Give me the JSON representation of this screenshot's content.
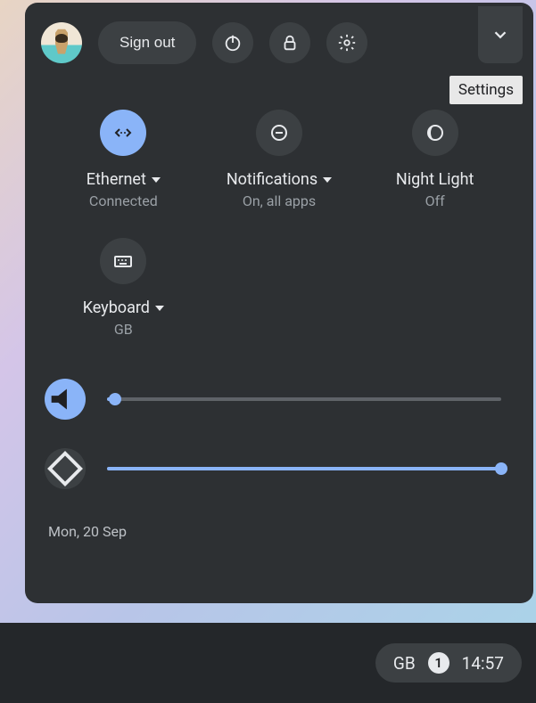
{
  "header": {
    "signout_label": "Sign out",
    "tooltip": "Settings"
  },
  "tiles": {
    "ethernet": {
      "label": "Ethernet",
      "sub": "Connected"
    },
    "notifications": {
      "label": "Notifications",
      "sub": "On, all apps"
    },
    "nightlight": {
      "label": "Night Light",
      "sub": "Off"
    },
    "keyboard": {
      "label": "Keyboard",
      "sub": "GB"
    }
  },
  "sliders": {
    "volume_pct": 2,
    "brightness_pct": 100
  },
  "footer": {
    "date": "Mon, 20 Sep"
  },
  "shelf": {
    "ime": "GB",
    "notif_count": "1",
    "clock": "14:57"
  },
  "colors": {
    "accent": "#8ab4f8",
    "panel": "#2d3033",
    "icon_bg": "#3c4043"
  }
}
